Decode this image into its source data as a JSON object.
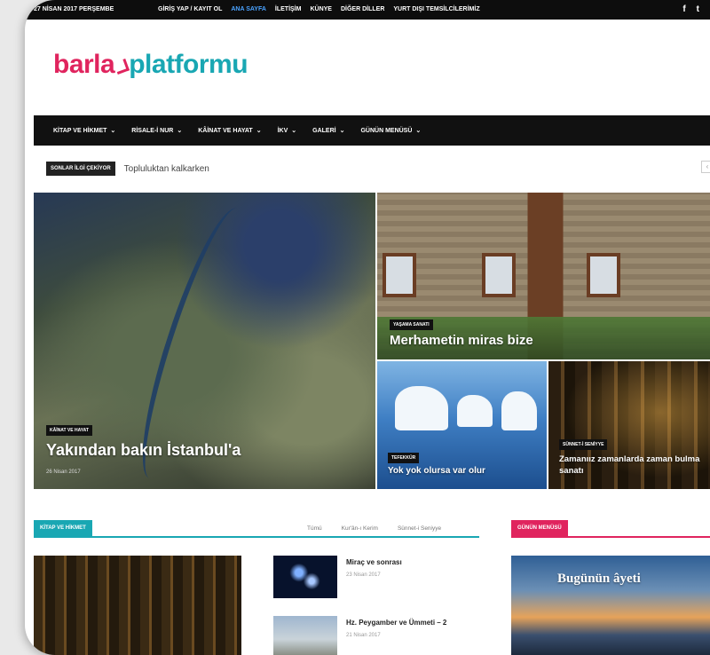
{
  "topbar": {
    "date": "27 NİSAN 2017 PERŞEMBE",
    "links": [
      {
        "label": "GİRİŞ YAP / KAYIT OL",
        "active": false
      },
      {
        "label": "ANA SAYFA",
        "active": true
      },
      {
        "label": "İLETİŞİM",
        "active": false
      },
      {
        "label": "KÜNYE",
        "active": false
      },
      {
        "label": "DİĞER DİLLER",
        "active": false
      },
      {
        "label": "YURT DIŞI TEMSİLCİLERİMİZ",
        "active": false
      }
    ],
    "social": [
      "f",
      "t"
    ]
  },
  "logo": {
    "part1": "barla",
    "part2": "platformu"
  },
  "nav": {
    "items": [
      "KİTAP VE HİKMET",
      "RİSALE-İ NUR",
      "KÂİNAT VE HAYAT",
      "İKV",
      "GALERİ",
      "GÜNÜN MENÜSÜ"
    ],
    "search_icon": "⌕"
  },
  "ticker": {
    "tag": "SONLAR İLGİ ÇEKİYOR",
    "text": "Topluluktan kalkarken",
    "prev": "‹",
    "next": "›"
  },
  "hero": {
    "main": {
      "category": "KÂİNAT VE HAYAT",
      "title": "Yakından bakın İstanbul'a",
      "date": "26 Nisan 2017"
    },
    "house": {
      "category": "YAŞAMA SANATI",
      "title": "Merhametin miras bize"
    },
    "ice": {
      "category": "TEFEKKÜR",
      "title": "Yok yok olursa var olur"
    },
    "city": {
      "category": "SÜNNET-İ SENİYYE",
      "title": "Zamanıız zamanlarda zaman bulma sanatı"
    }
  },
  "section_left": {
    "label": "KİTAP VE HİKMET",
    "tabs": [
      "Tümü",
      "Kur'ân-ı Kerim",
      "Sünnet-i Seniyye"
    ],
    "posts": [
      {
        "title": "Miraç ve sonrası",
        "date": "23 Nisan 2017"
      },
      {
        "title": "Hz. Peygamber ve Ümmeti – 2",
        "date": "21 Nisan 2017"
      }
    ]
  },
  "section_right": {
    "label": "GÜNÜN MENÜSÜ",
    "banner": "Bugünün âyeti"
  },
  "colors": {
    "brand_pink": "#e0245e",
    "brand_teal": "#19a7b3"
  }
}
